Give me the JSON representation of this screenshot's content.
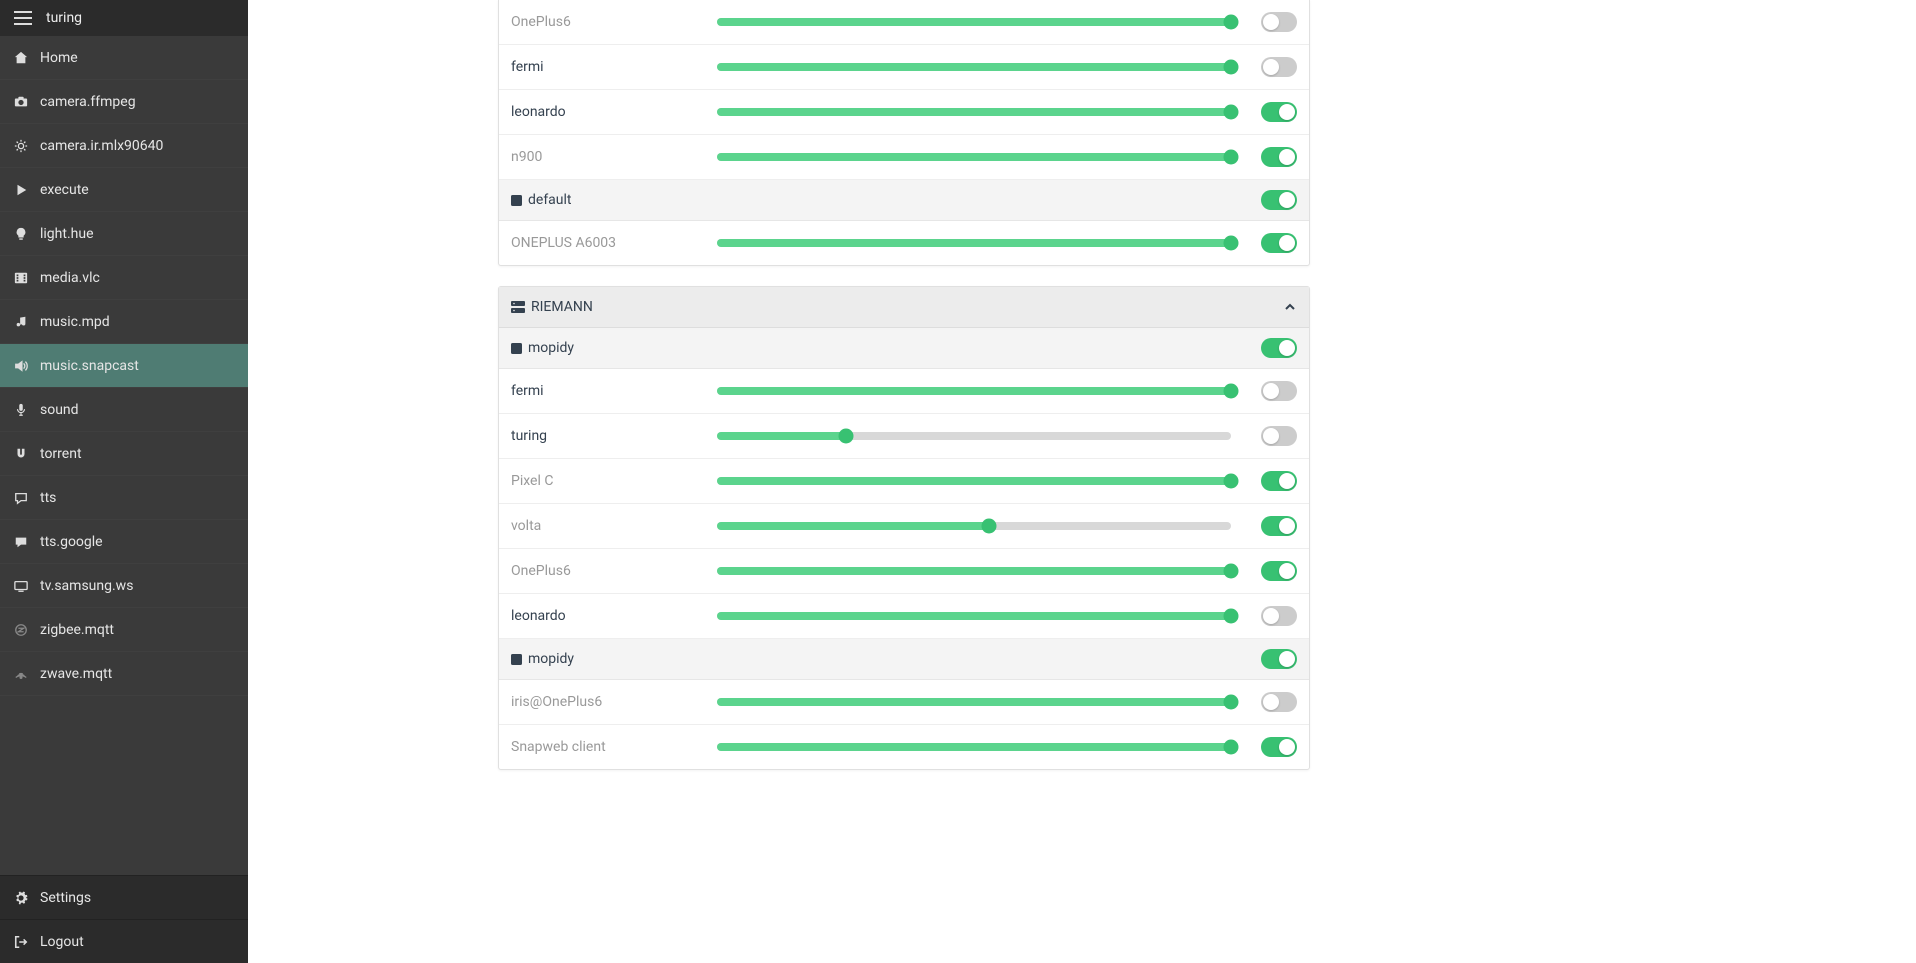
{
  "header": {
    "title": "turing"
  },
  "sidebar": {
    "items": [
      {
        "label": "Home",
        "icon": "home",
        "active": false
      },
      {
        "label": "camera.ffmpeg",
        "icon": "camera",
        "active": false
      },
      {
        "label": "camera.ir.mlx90640",
        "icon": "sun",
        "active": false
      },
      {
        "label": "execute",
        "icon": "play",
        "active": false
      },
      {
        "label": "light.hue",
        "icon": "bulb",
        "active": false
      },
      {
        "label": "media.vlc",
        "icon": "film",
        "active": false
      },
      {
        "label": "music.mpd",
        "icon": "music",
        "active": false
      },
      {
        "label": "music.snapcast",
        "icon": "volume",
        "active": true
      },
      {
        "label": "sound",
        "icon": "mic",
        "active": false
      },
      {
        "label": "torrent",
        "icon": "magnet",
        "active": false
      },
      {
        "label": "tts",
        "icon": "chat",
        "active": false
      },
      {
        "label": "tts.google",
        "icon": "chat-fill",
        "active": false
      },
      {
        "label": "tv.samsung.ws",
        "icon": "tv",
        "active": false
      },
      {
        "label": "zigbee.mqtt",
        "icon": "zigbee",
        "active": false
      },
      {
        "label": "zwave.mqtt",
        "icon": "zwave",
        "active": false
      }
    ],
    "footer": [
      {
        "label": "Settings",
        "icon": "gear"
      },
      {
        "label": "Logout",
        "icon": "logout"
      }
    ]
  },
  "main": {
    "top_group": {
      "rows": [
        {
          "label": "OnePlus6",
          "muted": true,
          "volume": 100,
          "toggle": false
        },
        {
          "label": "fermi",
          "muted": false,
          "volume": 100,
          "toggle": false
        },
        {
          "label": "leonardo",
          "muted": false,
          "volume": 100,
          "toggle": true
        },
        {
          "label": "n900",
          "muted": true,
          "volume": 100,
          "toggle": true
        }
      ],
      "subgroup": {
        "name": "default",
        "toggle": true,
        "rows": [
          {
            "label": "ONEPLUS A6003",
            "muted": true,
            "volume": 100,
            "toggle": true
          }
        ]
      }
    },
    "riemann": {
      "title": "RIEMANN",
      "subgroups": [
        {
          "name": "mopidy",
          "toggle": true,
          "rows": [
            {
              "label": "fermi",
              "muted": false,
              "volume": 100,
              "toggle": false
            },
            {
              "label": "turing",
              "muted": false,
              "volume": 25,
              "toggle": false
            },
            {
              "label": "Pixel C",
              "muted": true,
              "volume": 100,
              "toggle": true
            },
            {
              "label": "volta",
              "muted": true,
              "volume": 53,
              "toggle": true
            },
            {
              "label": "OnePlus6",
              "muted": true,
              "volume": 100,
              "toggle": true
            },
            {
              "label": "leonardo",
              "muted": false,
              "volume": 100,
              "toggle": false
            }
          ]
        },
        {
          "name": "mopidy",
          "toggle": true,
          "rows": [
            {
              "label": "iris@OnePlus6",
              "muted": true,
              "volume": 100,
              "toggle": false
            },
            {
              "label": "Snapweb client",
              "muted": true,
              "volume": 100,
              "toggle": true
            }
          ]
        }
      ]
    }
  }
}
